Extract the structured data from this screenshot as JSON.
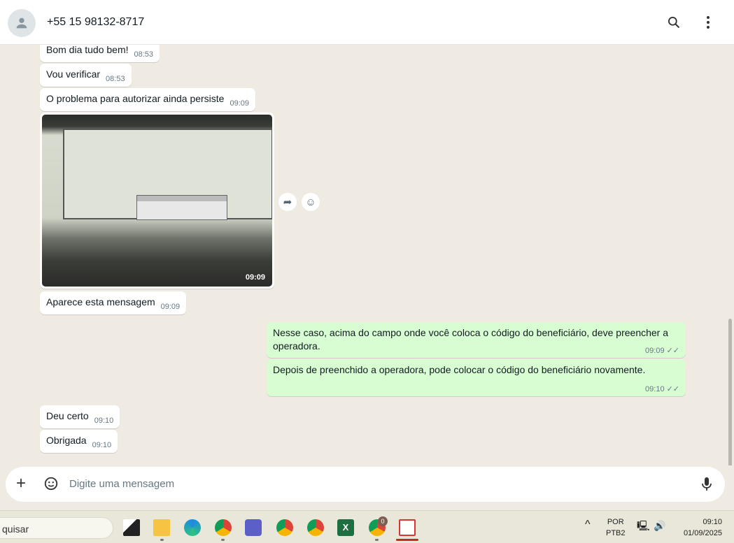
{
  "header": {
    "contact": "+55 15 98132-8717"
  },
  "messages": [
    {
      "text": "Bom dia tudo bem!",
      "time": "08:53"
    },
    {
      "text": "Vou verificar",
      "time": "08:53"
    },
    {
      "text": "O problema para autorizar ainda persiste",
      "time": "09:09"
    },
    {
      "image_time": "09:09"
    },
    {
      "text": "Aparece esta mensagem",
      "time": "09:09"
    },
    {
      "text": "Nesse caso, acima do campo onde você coloca o código do beneficiário, deve preencher a operadora.",
      "time": "09:09"
    },
    {
      "text": "Depois de preenchido a operadora, pode colocar o código do beneficiário novamente.",
      "time": "09:10"
    },
    {
      "text": "Deu certo",
      "time": "09:10"
    },
    {
      "text": "Obrigada",
      "time": "09:10"
    }
  ],
  "composer": {
    "placeholder": "Digite uma mensagem"
  },
  "taskbar": {
    "search": "quisar",
    "lang1": "POR",
    "lang2": "PTB2",
    "time": "09:10",
    "date": "01/09/2025",
    "badge": "0"
  },
  "colors": {
    "outgoing": "#d9fdd3",
    "chat_bg": "#efeae2"
  }
}
